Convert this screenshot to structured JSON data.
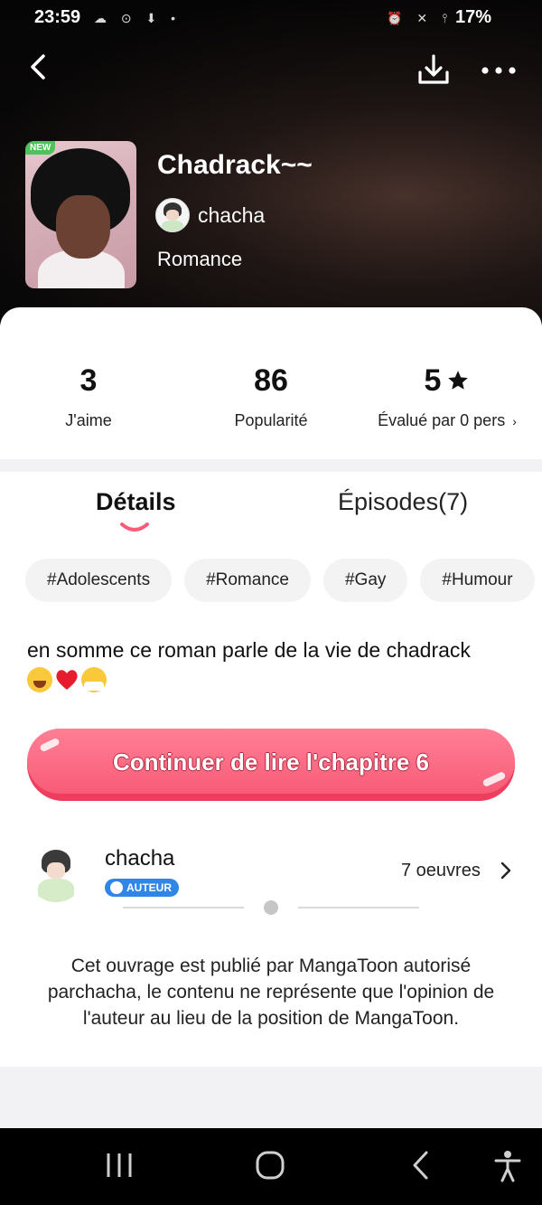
{
  "status_bar": {
    "time": "23:59",
    "battery": "17%",
    "left_icons": "☁ ⊙ ⬇ •",
    "right_icons": "⏰ ✕ ⫯"
  },
  "header": {
    "back_icon": "back-arrow-icon",
    "download_icon": "download-icon",
    "more_icon": "more-dots-icon",
    "cover_badge": "NEW",
    "title": "Chadrack~~",
    "author": "chacha",
    "genre": "Romance"
  },
  "stats": {
    "likes_value": "3",
    "likes_label": "J'aime",
    "popularity_value": "86",
    "popularity_label": "Popularité",
    "rating_value": "5",
    "rating_label": "Évalué par 0 pers"
  },
  "tabs": {
    "details": "Détails",
    "episodes": "Épisodes(7)"
  },
  "tags": [
    "#Adolescents",
    "#Romance",
    "#Gay",
    "#Humour"
  ],
  "description": "en somme ce roman parle de la vie de chadrack",
  "cta_label": "Continuer de lire l'chapitre 6",
  "author_section": {
    "name": "chacha",
    "badge": "AUTEUR",
    "works": "7 oeuvres"
  },
  "disclaimer": "Cet ouvrage est publié par MangaToon  autorisé parchacha, le contenu ne représente que l'opinion de l'auteur au lieu de la position de MangaToon.",
  "colors": {
    "accent": "#f85c77",
    "cta_shadow": "#ef3d5f",
    "badge_blue": "#2f86e6",
    "new_green": "#4cc45a"
  }
}
